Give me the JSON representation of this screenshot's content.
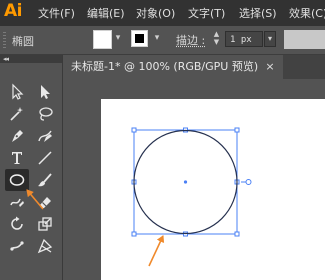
{
  "app": {
    "logo": "Ai"
  },
  "menu": [
    "文件(F)",
    "编辑(E)",
    "对象(O)",
    "文字(T)",
    "选择(S)",
    "效果(C)"
  ],
  "control_bar": {
    "shape_name": "椭圆",
    "stroke_label": "描边 :",
    "stroke_value": "1 px"
  },
  "document": {
    "tab_title": "未标题-1* @ 100% (RGB/GPU 预览)",
    "close_glyph": "×"
  },
  "toolbox": {
    "collapse_glyph": "◂◂",
    "tools": [
      "selection-tool",
      "direct-selection-tool",
      "magic-wand-tool",
      "lasso-tool",
      "pen-tool",
      "curvature-tool",
      "type-tool",
      "line-segment-tool",
      "ellipse-tool",
      "paintbrush-tool",
      "shaper-tool",
      "eraser-tool",
      "rotate-tool",
      "scale-tool",
      "puppet-warp-tool",
      "free-transform-tool"
    ],
    "active_tool": "ellipse-tool"
  },
  "colors": {
    "app_background": "#535353",
    "menubar": "#323232",
    "logo": "#ff9a00",
    "selection": "#4a80f5",
    "annotation_arrow": "#f08a2c"
  }
}
